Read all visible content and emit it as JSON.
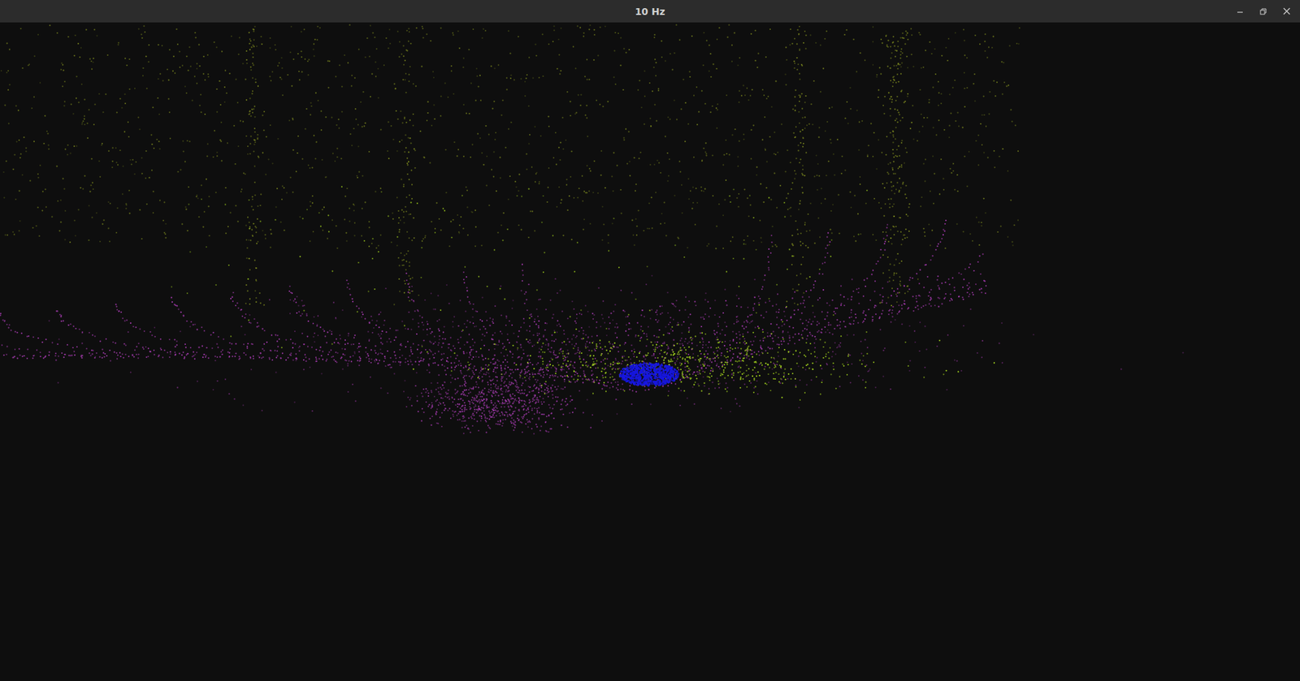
{
  "window": {
    "title": "10 Hz"
  },
  "point_classes": [
    {
      "kind": "structure",
      "color": "#8c9a22"
    },
    {
      "kind": "rings",
      "color": "#a63cb0"
    },
    {
      "kind": "vegetation",
      "color": "#a4d41e"
    },
    {
      "kind": "object",
      "color": "#1717e0"
    }
  ]
}
